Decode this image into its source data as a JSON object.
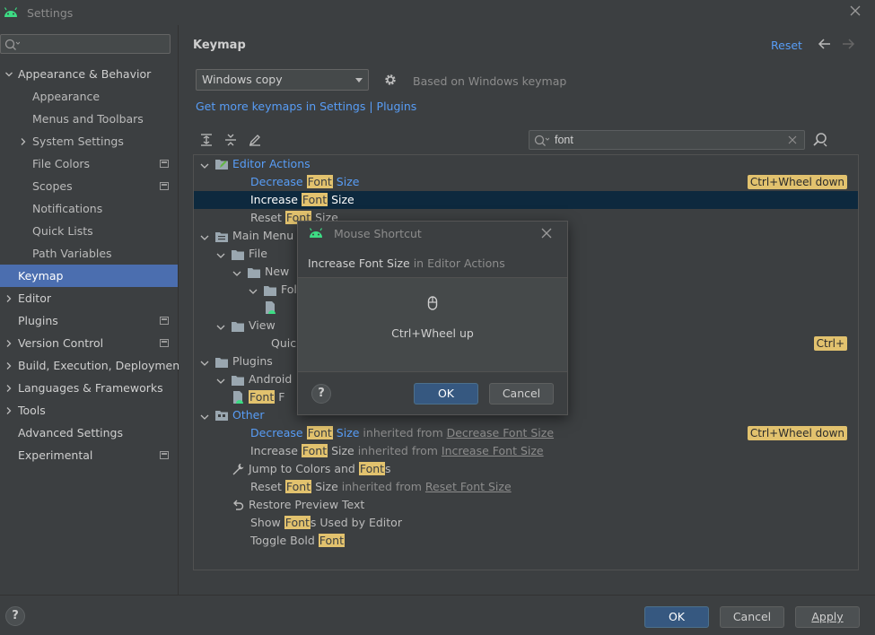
{
  "window": {
    "title": "Settings"
  },
  "sidebar": {
    "search_value": "",
    "items": [
      {
        "label": "Appearance & Behavior",
        "level": 0,
        "expandable": true,
        "expanded": true,
        "project": false
      },
      {
        "label": "Appearance",
        "level": 1,
        "expandable": false,
        "project": false
      },
      {
        "label": "Menus and Toolbars",
        "level": 1,
        "expandable": false,
        "project": false
      },
      {
        "label": "System Settings",
        "level": 1,
        "expandable": true,
        "expanded": false,
        "project": false
      },
      {
        "label": "File Colors",
        "level": 1,
        "expandable": false,
        "project": true
      },
      {
        "label": "Scopes",
        "level": 1,
        "expandable": false,
        "project": true
      },
      {
        "label": "Notifications",
        "level": 1,
        "expandable": false,
        "project": false
      },
      {
        "label": "Quick Lists",
        "level": 1,
        "expandable": false,
        "project": false
      },
      {
        "label": "Path Variables",
        "level": 1,
        "expandable": false,
        "project": false
      },
      {
        "label": "Keymap",
        "level": 0,
        "expandable": false,
        "project": false,
        "selected": true
      },
      {
        "label": "Editor",
        "level": 0,
        "expandable": true,
        "expanded": false,
        "project": false
      },
      {
        "label": "Plugins",
        "level": 0,
        "expandable": false,
        "project": true
      },
      {
        "label": "Version Control",
        "level": 0,
        "expandable": true,
        "expanded": false,
        "project": true
      },
      {
        "label": "Build, Execution, Deployment",
        "level": 0,
        "expandable": true,
        "expanded": false,
        "project": false
      },
      {
        "label": "Languages & Frameworks",
        "level": 0,
        "expandable": true,
        "expanded": false,
        "project": false
      },
      {
        "label": "Tools",
        "level": 0,
        "expandable": true,
        "expanded": false,
        "project": false
      },
      {
        "label": "Advanced Settings",
        "level": 0,
        "expandable": false,
        "project": false
      },
      {
        "label": "Experimental",
        "level": 0,
        "expandable": false,
        "project": true
      }
    ]
  },
  "main": {
    "title": "Keymap",
    "reset_label": "Reset",
    "keymap_selected": "Windows copy",
    "based_on": "Based on Windows keymap",
    "get_more": "Get more keymaps in Settings | Plugins",
    "filter_value": "font"
  },
  "tree": [
    {
      "indent": 0,
      "chev": "down",
      "icon": "editor-actions",
      "parts": [
        {
          "t": "Editor Actions"
        }
      ],
      "group": true
    },
    {
      "indent": 2,
      "parts": [
        {
          "t": "Decrease "
        },
        {
          "t": "Font",
          "h": true
        },
        {
          "t": " Size"
        }
      ],
      "blue": true,
      "shortcut": "Ctrl+Wheel down"
    },
    {
      "indent": 2,
      "parts": [
        {
          "t": "Increase "
        },
        {
          "t": "Font",
          "h": true
        },
        {
          "t": " Size"
        }
      ],
      "selected": true
    },
    {
      "indent": 2,
      "parts": [
        {
          "t": "Reset "
        },
        {
          "t": "Font",
          "h": true
        },
        {
          "t": " Size"
        }
      ]
    },
    {
      "indent": 0,
      "chev": "down",
      "icon": "menu",
      "parts": [
        {
          "t": "Main Menu"
        }
      ]
    },
    {
      "indent": 1,
      "chev": "down",
      "icon": "folder",
      "parts": [
        {
          "t": "File"
        }
      ]
    },
    {
      "indent": 2,
      "chev": "down",
      "icon": "folder",
      "parts": [
        {
          "t": "New"
        }
      ]
    },
    {
      "indent": 3,
      "chev": "down",
      "icon": "folder",
      "parts": [
        {
          "t": "Fol"
        }
      ]
    },
    {
      "indent": 4,
      "icon": "android-file",
      "parts": []
    },
    {
      "indent": 1,
      "chev": "down",
      "icon": "folder",
      "parts": [
        {
          "t": "View"
        }
      ]
    },
    {
      "indent": 3,
      "parts": [
        {
          "t": "Quick"
        }
      ],
      "shortcut": "Ctrl+"
    },
    {
      "indent": 0,
      "chev": "down",
      "icon": "folder",
      "parts": [
        {
          "t": "Plugins"
        }
      ]
    },
    {
      "indent": 1,
      "chev": "down",
      "icon": "folder",
      "parts": [
        {
          "t": "Android"
        }
      ]
    },
    {
      "indent": 2,
      "icon": "android-file",
      "parts": [
        {
          "t": "Font",
          "h": true
        },
        {
          "t": " F"
        }
      ]
    },
    {
      "indent": 0,
      "chev": "down",
      "icon": "other",
      "parts": [
        {
          "t": "Other"
        }
      ],
      "group": true
    },
    {
      "indent": 2,
      "parts": [
        {
          "t": "Decrease "
        },
        {
          "t": "Font",
          "h": true
        },
        {
          "t": " Size"
        },
        {
          "t": " inherited from ",
          "c": "inh"
        },
        {
          "t": "Decrease Font Size",
          "c": "link-u"
        }
      ],
      "blue": true,
      "shortcut": "Ctrl+Wheel down"
    },
    {
      "indent": 2,
      "parts": [
        {
          "t": "Increase "
        },
        {
          "t": "Font",
          "h": true
        },
        {
          "t": " Size"
        },
        {
          "t": " inherited from ",
          "c": "inh"
        },
        {
          "t": "Increase Font Size",
          "c": "link-u"
        }
      ]
    },
    {
      "indent": 2,
      "icon": "wrench",
      "parts": [
        {
          "t": "Jump to Colors and "
        },
        {
          "t": "Font",
          "h": true
        },
        {
          "t": "s"
        }
      ]
    },
    {
      "indent": 2,
      "parts": [
        {
          "t": "Reset "
        },
        {
          "t": "Font",
          "h": true
        },
        {
          "t": " Size"
        },
        {
          "t": " inherited from ",
          "c": "inh"
        },
        {
          "t": "Reset Font Size",
          "c": "link-u"
        }
      ]
    },
    {
      "indent": 2,
      "icon": "undo",
      "parts": [
        {
          "t": "Restore Preview Text"
        }
      ]
    },
    {
      "indent": 2,
      "parts": [
        {
          "t": "Show "
        },
        {
          "t": "Font",
          "h": true
        },
        {
          "t": "s Used by Editor"
        }
      ]
    },
    {
      "indent": 2,
      "parts": [
        {
          "t": "Toggle Bold "
        },
        {
          "t": "Font",
          "h": true
        }
      ]
    }
  ],
  "footer": {
    "ok": "OK",
    "cancel": "Cancel",
    "apply": "Apply",
    "help": "?"
  },
  "dialog": {
    "title": "Mouse Shortcut",
    "action": "Increase Font Size",
    "context": " in Editor Actions",
    "shortcut": "Ctrl+Wheel up",
    "ok": "OK",
    "cancel": "Cancel",
    "help": "?"
  },
  "colors": {
    "accent": "#4b6eaf",
    "link": "#589df6",
    "highlight": "#e2c26e",
    "selection": "#0d293e"
  }
}
